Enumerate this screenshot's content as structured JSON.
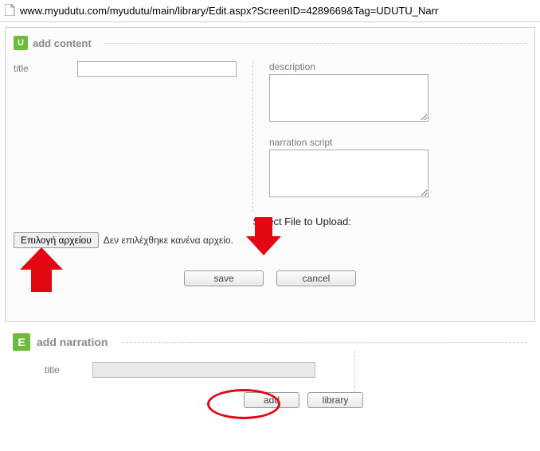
{
  "url_bar": {
    "text": "www.myudutu.com/myudutu/main/library/Edit.aspx?ScreenID=4289669&Tag=UDUTU_Narr"
  },
  "panel1": {
    "icon_letter": "U",
    "heading": "add content",
    "title_label": "title",
    "title_value": "",
    "description_label": "description",
    "description_value": "",
    "narration_label": "narration script",
    "narration_value": "",
    "upload_label": "Select File to Upload:",
    "file_button": "Επιλογή αρχείου",
    "file_status": "Δεν επιλέχθηκε κανένα αρχείο.",
    "save_label": "save",
    "cancel_label": "cancel"
  },
  "panel2": {
    "icon_letter": "E",
    "heading": "add narration",
    "title_label": "title",
    "title_value": "",
    "add_label": "add",
    "library_label": "library"
  }
}
